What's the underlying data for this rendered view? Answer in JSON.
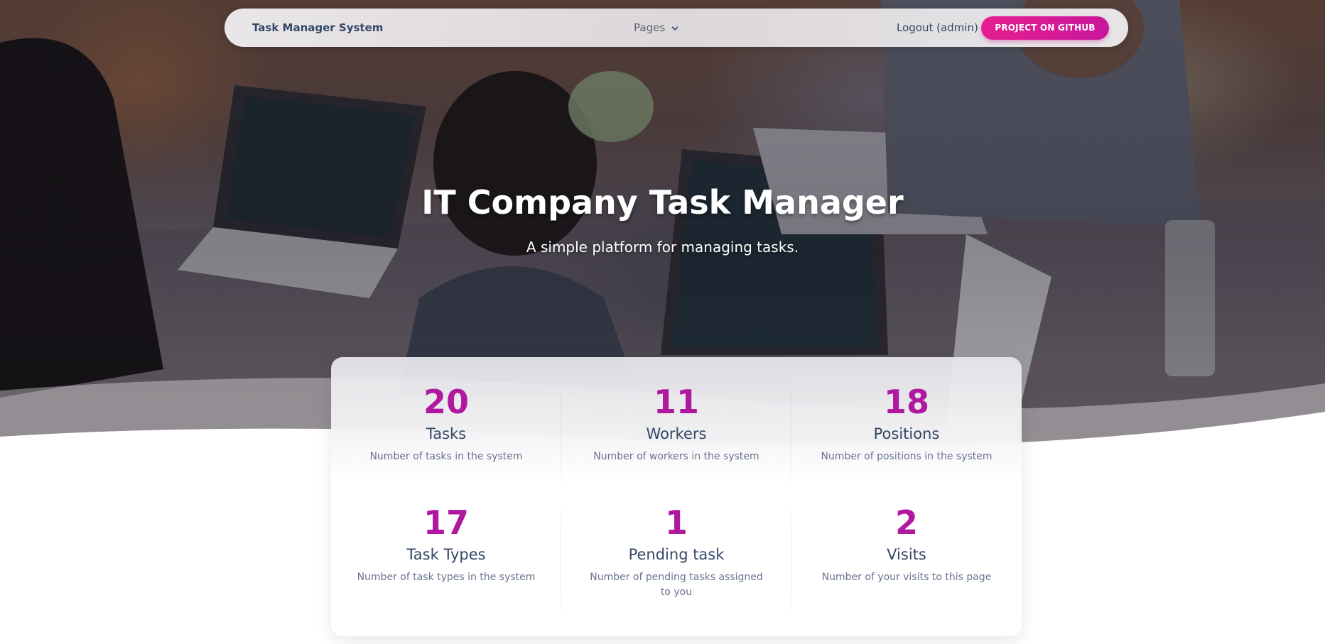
{
  "navbar": {
    "brand": "Task Manager System",
    "pages_label": "Pages",
    "logout_label": "Logout (admin)",
    "github_label": "PROJECT ON GITHUB"
  },
  "hero": {
    "title": "IT Company Task Manager",
    "subtitle": "A simple platform for managing tasks."
  },
  "stats": [
    {
      "value": "20",
      "label": "Tasks",
      "description": "Number of tasks in the system"
    },
    {
      "value": "11",
      "label": "Workers",
      "description": "Number of workers in the system"
    },
    {
      "value": "18",
      "label": "Positions",
      "description": "Number of positions in the system"
    },
    {
      "value": "17",
      "label": "Task Types",
      "description": "Number of task types in the system"
    },
    {
      "value": "1",
      "label": "Pending task",
      "description": "Number of pending tasks assigned to you"
    },
    {
      "value": "2",
      "label": "Visits",
      "description": "Number of your visits to this page"
    }
  ],
  "colors": {
    "accent": "#b0199f",
    "button_gradient_start": "#e61e8f",
    "button_gradient_end": "#c8179c",
    "text_dark": "#344767",
    "text_muted": "#67748e"
  },
  "icons": {
    "pages_dropdown": "chevron-down-icon"
  }
}
